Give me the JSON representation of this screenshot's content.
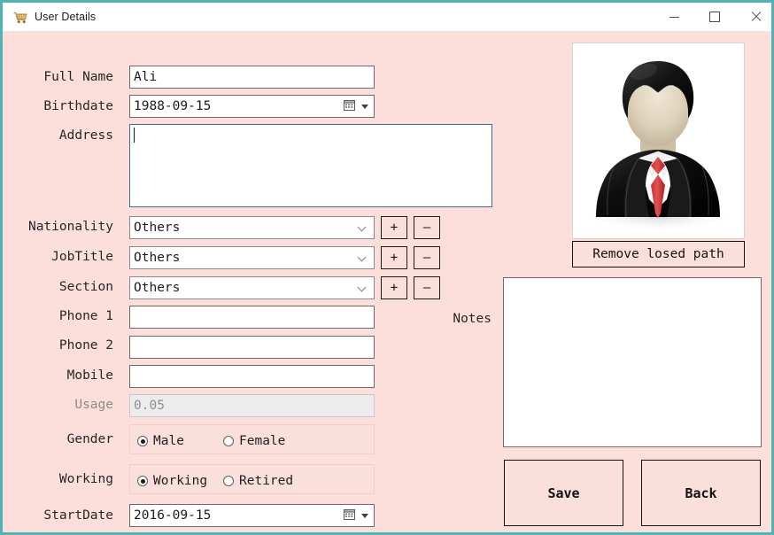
{
  "window": {
    "title": "User Details",
    "icon": "shopping-cart-icon",
    "controls": {
      "minimize": "–",
      "maximize": "□",
      "close": "×"
    },
    "colors": {
      "background": "#fcdfdb",
      "border": "#4fb3b3",
      "titlebar": "#ffffff",
      "button_face": "#fbdfdb",
      "field_background": "#ffffff",
      "field_border": "#6f6a67",
      "disabled_background": "#ececec",
      "disabled_text": "#8f8f8f",
      "focus_border": "#3a6f96"
    }
  },
  "form": {
    "full_name": {
      "label": "Full Name",
      "value": "Ali",
      "placeholder": ""
    },
    "birthdate": {
      "label": "Birthdate",
      "value": "1988-09-15",
      "picker_icon": "calendar-icon"
    },
    "address": {
      "label": "Address",
      "value": "",
      "placeholder": "",
      "focused": true
    },
    "nationality": {
      "label": "Nationality",
      "value": "Others",
      "add": "+",
      "remove": "–"
    },
    "jobtitle": {
      "label": "JobTitle",
      "value": "Others",
      "add": "+",
      "remove": "–"
    },
    "section": {
      "label": "Section",
      "value": "Others",
      "add": "+",
      "remove": "–"
    },
    "phone1": {
      "label": "Phone 1",
      "value": "",
      "placeholder": ""
    },
    "phone2": {
      "label": "Phone 2",
      "value": "",
      "placeholder": ""
    },
    "mobile": {
      "label": "Mobile",
      "value": "",
      "placeholder": ""
    },
    "usage": {
      "label": "Usage",
      "value": "0.05",
      "disabled": true
    },
    "gender": {
      "label": "Gender",
      "options": [
        {
          "label": "Male",
          "selected": true
        },
        {
          "label": "Female",
          "selected": false
        }
      ]
    },
    "working": {
      "label": "Working",
      "options": [
        {
          "label": "Working",
          "selected": true
        },
        {
          "label": "Retired",
          "selected": false
        }
      ]
    },
    "startdate": {
      "label": "StartDate",
      "value": "2016-09-15",
      "picker_icon": "calendar-icon"
    }
  },
  "right_panel": {
    "avatar": {
      "name": "user-avatar",
      "description": "businessman-in-black-suit-with-red-tie"
    },
    "remove_path_button": "Remove losed path",
    "notes": {
      "label": "Notes",
      "value": "",
      "placeholder": ""
    },
    "save_button": "Save",
    "back_button": "Back"
  }
}
